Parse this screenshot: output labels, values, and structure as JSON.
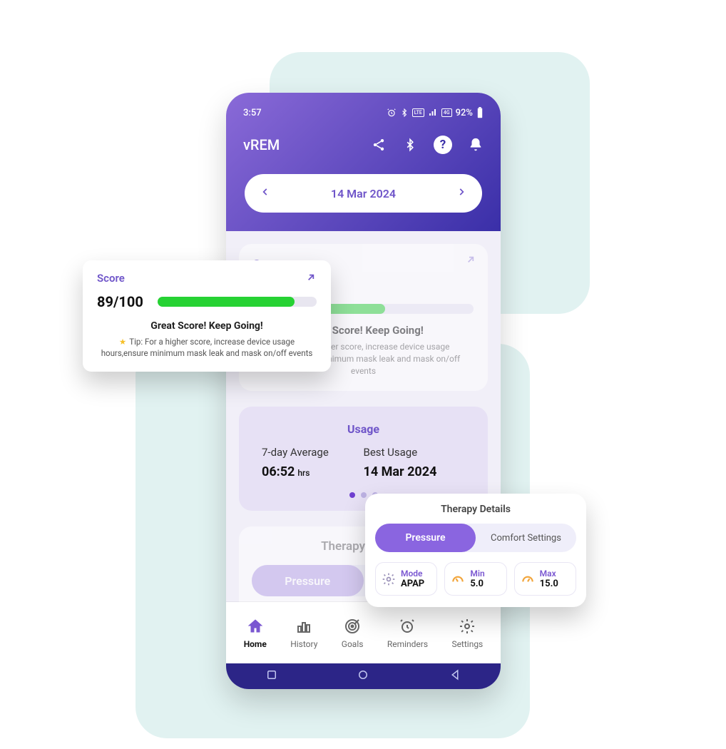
{
  "status": {
    "time": "3:57",
    "battery": "92%"
  },
  "app": {
    "title": "vREM"
  },
  "date": "14 Mar 2024",
  "score": {
    "title": "Score",
    "value": "89/100",
    "percent": 86,
    "headline": "Great Score! Keep Going!",
    "tip": "Tip: For a higher score, increase device usage hours,ensure minimum mask leak and mask on/off events"
  },
  "score_dim": {
    "title": "Score",
    "value": "89/100",
    "headline": "Great Score! Keep Going!",
    "tip": "Tip: For a higher score, increase device usage hours,ensure minimum mask leak and mask on/off events"
  },
  "usage": {
    "title": "Usage",
    "avg_label": "7-day Average",
    "avg_value": "06:52",
    "avg_unit": "hrs",
    "best_label": "Best Usage",
    "best_value": "14 Mar 2024"
  },
  "therapy_dim": {
    "title": "Therapy Details",
    "seg_pressure": "Pressure",
    "seg_comfort": "Comfort Settings",
    "mode_label": "Mode",
    "mode_value": "APAP",
    "min_label": "Min",
    "min_value": "5.0",
    "max_label": "Max",
    "max_value": "15.0"
  },
  "therapy": {
    "title": "Therapy Details",
    "seg_pressure": "Pressure",
    "seg_comfort": "Comfort Settings",
    "mode_label": "Mode",
    "mode_value": "APAP",
    "min_label": "Min",
    "min_value": "5.0",
    "max_label": "Max",
    "max_value": "15.0"
  },
  "nav": {
    "home": "Home",
    "history": "History",
    "goals": "Goals",
    "reminders": "Reminders",
    "settings": "Settings"
  }
}
